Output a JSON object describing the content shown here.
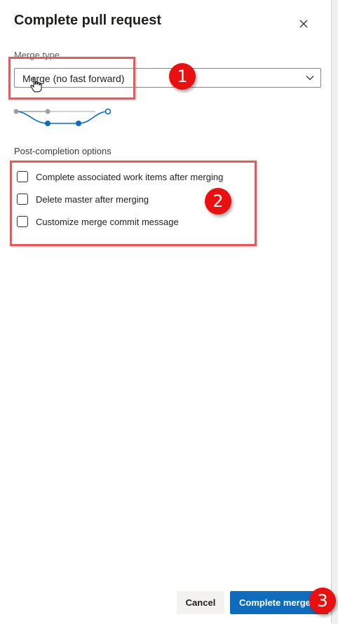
{
  "dialog": {
    "title": "Complete pull request",
    "close_icon": "close-icon"
  },
  "merge_type": {
    "label": "Merge type",
    "selected": "Merge (no fast forward)",
    "chevron_icon": "chevron-down-icon"
  },
  "post_completion": {
    "label": "Post-completion options",
    "options": [
      {
        "label": "Complete associated work items after merging",
        "checked": false
      },
      {
        "label": "Delete master after merging",
        "checked": false
      },
      {
        "label": "Customize merge commit message",
        "checked": false
      }
    ]
  },
  "footer": {
    "cancel_label": "Cancel",
    "complete_label": "Complete merge"
  },
  "annotations": {
    "badge_1": "1",
    "badge_2": "2",
    "badge_3": "3"
  },
  "colors": {
    "accent": "#0f6cbd",
    "annotation_box": "#e05c5f",
    "badge": "#e81010"
  }
}
